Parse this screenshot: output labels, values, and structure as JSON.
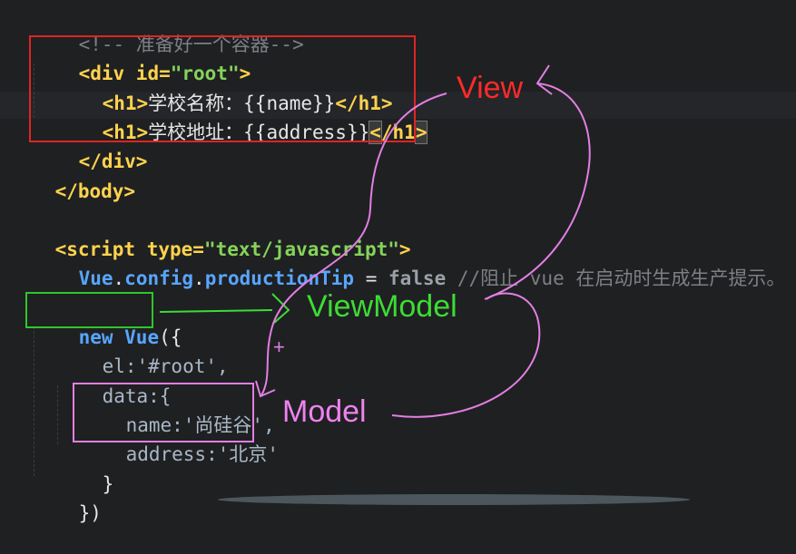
{
  "code": {
    "comment": "<!-- 准备好一个容器-->",
    "div_open": {
      "tag_open": "<div",
      "attr": " id=",
      "value": "\"root\"",
      "tag_close": ">"
    },
    "h1_name": {
      "open": "<h1>",
      "text": "学校名称：{{name}}",
      "close": "</h1>"
    },
    "h1_address": {
      "open": "<h1>",
      "text": "学校地址：{{address}}",
      "close_part1": "<",
      "close_part2": "/h1",
      "close_part3": ">"
    },
    "div_close": "</div>",
    "body_close": "</body>",
    "script_open": {
      "tag": "<script",
      "attr": " type=",
      "value": "\"text/javascript\"",
      "close": ">"
    },
    "config_line": {
      "obj": "Vue",
      "dot1": ".",
      "config": "config",
      "dot2": ".",
      "prop": "productionTip",
      "eq": " = ",
      "val": "false",
      "comment": " //阻止 vue 在启动时生成生产提示。"
    },
    "new_vue": {
      "kw": "new",
      "cls": " Vue",
      "rest": "({"
    },
    "el_line": "el:'#root',",
    "data_line": "data:{",
    "name_line": "name:'尚硅谷',",
    "address_line": "address:'北京'",
    "close_brace": "}",
    "close_paren": "})"
  },
  "annotations": {
    "view": "View",
    "viewmodel": "ViewModel",
    "model": "Model",
    "plus": "+"
  },
  "colors": {
    "view": "#ff2a2a",
    "viewmodel": "#3ddc35",
    "model": "#ee82ee",
    "background": "#1f2022"
  }
}
